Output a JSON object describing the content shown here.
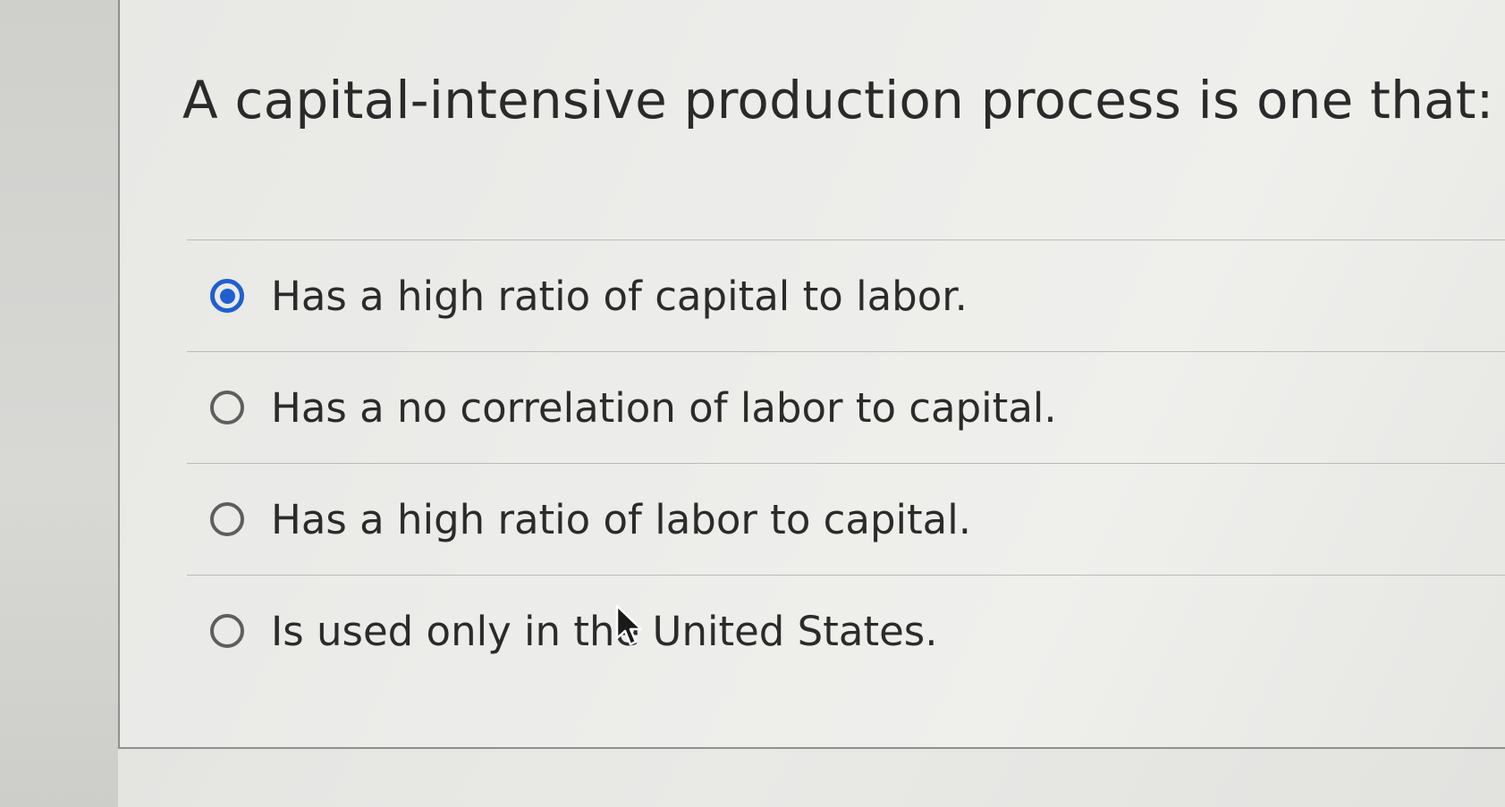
{
  "question": {
    "text": "A capital-intensive production process is one that:"
  },
  "options": [
    {
      "label": "Has a high ratio of capital to labor.",
      "selected": true
    },
    {
      "label": "Has a no correlation of labor to capital.",
      "selected": false
    },
    {
      "label": "Has a high ratio of labor to capital.",
      "selected": false
    },
    {
      "label": "Is used only in the United States.",
      "selected": false
    }
  ],
  "colors": {
    "accent": "#1f5fd0",
    "text": "#2b2b2b",
    "divider": "#b9b9b6"
  },
  "icons": {
    "cursor": "arrow-cursor-icon"
  }
}
